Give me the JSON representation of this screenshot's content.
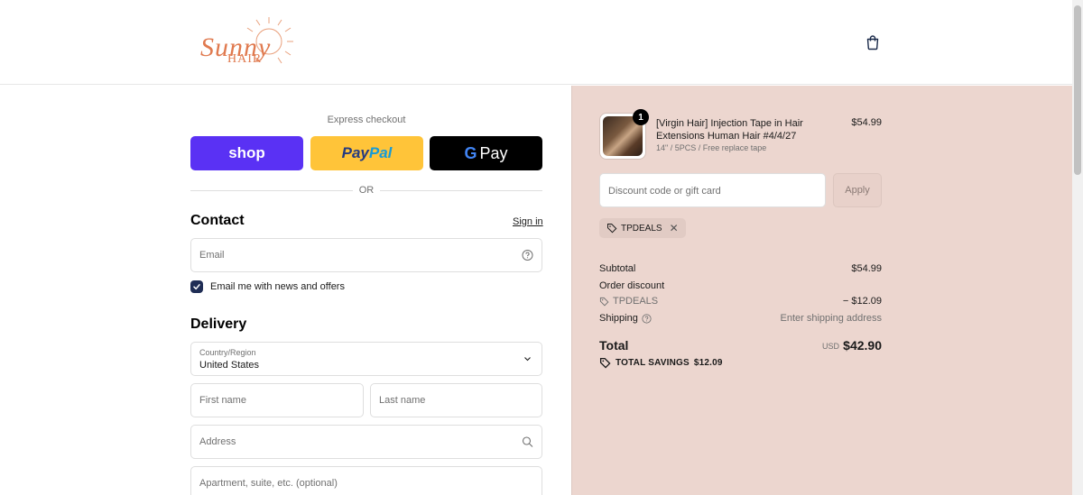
{
  "header": {
    "logo_line1": "Sunny",
    "logo_line2": "HAIR"
  },
  "express": {
    "label": "Express checkout",
    "shop_label": "shop",
    "paypal_part1": "Pay",
    "paypal_part2": "Pal",
    "gpay_g": "G",
    "gpay_label": "Pay",
    "or_text": "OR"
  },
  "contact": {
    "title": "Contact",
    "signin": "Sign in",
    "email_placeholder": "Email",
    "newsletter_label": "Email me with news and offers",
    "newsletter_checked": true
  },
  "delivery": {
    "title": "Delivery",
    "country_label": "Country/Region",
    "country_value": "United States",
    "first_name_placeholder": "First name",
    "last_name_placeholder": "Last name",
    "address_placeholder": "Address",
    "apartment_placeholder": "Apartment, suite, etc. (optional)"
  },
  "order": {
    "quantity": "1",
    "product_title": "[Virgin Hair] Injection Tape in Hair Extensions Human Hair #4/4/27",
    "product_variant": "14\" / 5PCS / Free replace tape",
    "product_price": "$54.99",
    "discount_placeholder": "Discount code or gift card",
    "apply_label": "Apply",
    "applied_code": "TPDEALS",
    "subtotal_label": "Subtotal",
    "subtotal_value": "$54.99",
    "order_discount_label": "Order discount",
    "discount_code_label": "TPDEALS",
    "discount_value": "− $12.09",
    "shipping_label": "Shipping",
    "shipping_value": "Enter shipping address",
    "total_label": "Total",
    "total_currency": "USD",
    "total_value": "$42.90",
    "savings_label": "TOTAL SAVINGS",
    "savings_value": "$12.09"
  },
  "colors": {
    "shop": "#5a31f4",
    "paypal": "#ffc439",
    "gpay": "#000000",
    "summary_bg": "#ecd6cf",
    "brand": "#e07a4f"
  }
}
